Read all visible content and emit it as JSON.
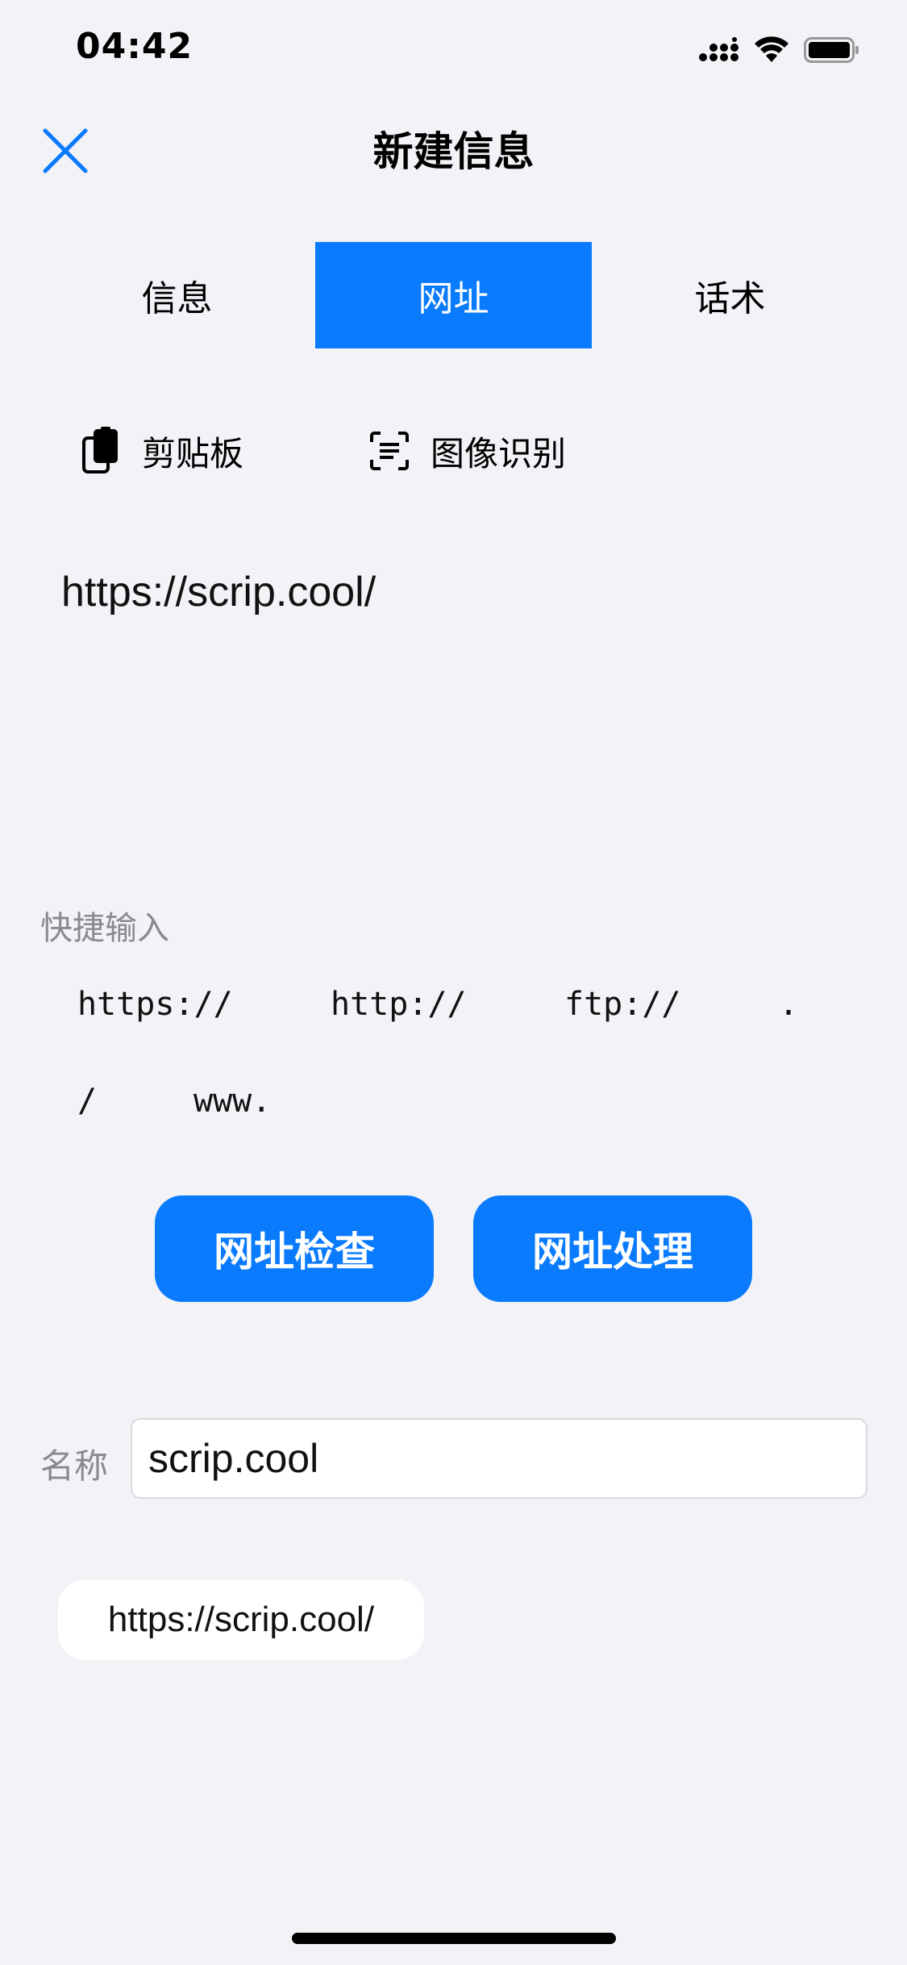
{
  "status_bar": {
    "time": "04:42",
    "icons": [
      "cellular-signal-icon",
      "wifi-icon",
      "battery-icon"
    ]
  },
  "nav": {
    "title": "新建信息",
    "close_icon": "close-icon"
  },
  "tabs": [
    {
      "label": "信息",
      "active": false
    },
    {
      "label": "网址",
      "active": true
    },
    {
      "label": "话术",
      "active": false
    }
  ],
  "tools": {
    "clipboard": {
      "label": "剪贴板",
      "icon": "clipboard-icon"
    },
    "image_recognition": {
      "label": "图像识别",
      "icon": "scan-text-icon"
    }
  },
  "editor": {
    "value": "https://scrip.cool/"
  },
  "quick_input": {
    "label": "快捷输入",
    "items": [
      "https://",
      "http://",
      "ftp://",
      ".",
      "/",
      "www."
    ]
  },
  "buttons": {
    "check_label": "网址检查",
    "process_label": "网址处理"
  },
  "name_field": {
    "label": "名称",
    "value": "scrip.cool"
  },
  "url_chip": {
    "label": "https://scrip.cool/"
  },
  "colors": {
    "accent": "#0a7bfd",
    "background": "#f2f2f7",
    "label_gray": "#8a8a8e"
  }
}
